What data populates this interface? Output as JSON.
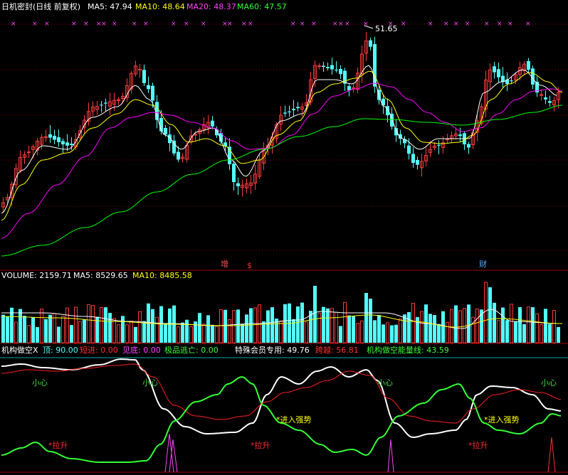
{
  "colors": {
    "background": "#000000",
    "up": "#ff3b3b",
    "down": "#54ffff",
    "ma5": "#ffffff",
    "ma10": "#ffff00",
    "ma20": "#ff00ff",
    "ma60": "#00ff00",
    "separator": "#a00000",
    "dotted_grid": "#8a0000",
    "white_line": "#ffffff",
    "red_line": "#ff2020",
    "green_line": "#33ff33",
    "magenta_line": "#ff44ff",
    "label_yellow": "#ffff00",
    "label_red": "#ff3030",
    "label_green": "#44dd44",
    "top_line": "#00aaaa"
  },
  "header": {
    "title": "日机密封(日线 前复权)",
    "ma5": "MA5: 47.94",
    "ma10": "MA10: 48.64",
    "ma20": "MA20: 48.37",
    "ma60": "MA60: 47.57"
  },
  "volume_header": {
    "label": "VOLUME: 2159.71",
    "ma5": "MA5: 8529.65",
    "ma10": "MA10: 8485.58"
  },
  "indicator_header": {
    "name": "机构做空X",
    "top": "顶: 90.00",
    "short_in": "短进: 0.00",
    "bottom": "见底: 0.00",
    "escape": "极品逃亡: 0.00",
    "vip": "特殊会员专用: 49.76",
    "cross": "跨越: 56.81",
    "energy": "机构做空能量线: 43.59"
  },
  "annotations": {
    "high_price": "51.65",
    "event_zeng": "增",
    "event_s": "$",
    "event_cai": "财",
    "caution": "小心",
    "strong": "*进入强势",
    "pull_up": "*拉升"
  },
  "chart_data": [
    {
      "type": "candlestick",
      "title": "日机密封(日线 前复权)",
      "annotation_high": 51.65,
      "moving_averages": {
        "MA5": 47.94,
        "MA10": 48.64,
        "MA20": 48.37,
        "MA60": 47.57
      },
      "series": [
        {
          "name": "MA60",
          "values": [
            40.6,
            40.7,
            40.8,
            41.0,
            41.2,
            41.4,
            41.6,
            41.9,
            42.2,
            42.6,
            43.0,
            43.5,
            44.0,
            44.4,
            44.9,
            45.3,
            45.6,
            45.9,
            46.2,
            46.3,
            46.5,
            46.6,
            46.7,
            46.8,
            46.9,
            47.0,
            47.2,
            47.3
          ]
        },
        {
          "name": "MA20",
          "values": [
            41.0,
            41.8,
            42.8,
            43.8,
            44.8,
            45.6,
            46.3,
            46.4,
            46.2,
            45.8,
            45.3,
            45.2,
            45.6,
            46.4,
            47.2,
            48.0,
            48.7,
            48.9,
            48.6,
            47.9,
            47.0,
            46.5,
            46.2,
            46.5,
            47.3,
            48.1,
            48.7,
            48.4
          ]
        }
      ],
      "ohlc_sample": [
        {
          "o": 43.2,
          "h": 44.0,
          "l": 42.5,
          "c": 43.8
        },
        {
          "o": 43.8,
          "h": 45.6,
          "l": 43.4,
          "c": 45.1
        },
        {
          "o": 45.1,
          "h": 47.2,
          "l": 44.6,
          "c": 46.8
        },
        {
          "o": 46.8,
          "h": 49.3,
          "l": 46.2,
          "c": 48.9
        },
        {
          "o": 48.9,
          "h": 49.8,
          "l": 47.0,
          "c": 47.4
        }
      ]
    },
    {
      "type": "bar",
      "title": "VOLUME",
      "values_summary": {
        "VOLUME": 2159.71,
        "MA5": 8529.65,
        "MA10": 8485.58
      }
    },
    {
      "type": "line",
      "title": "机构做空X",
      "series": [
        {
          "name": "顶",
          "values": [
            90.0
          ]
        },
        {
          "name": "特殊会员专用",
          "values": [
            49.76
          ]
        },
        {
          "name": "跨越",
          "values": [
            56.81
          ]
        },
        {
          "name": "机构做空能量线",
          "values": [
            43.59
          ]
        }
      ]
    }
  ]
}
